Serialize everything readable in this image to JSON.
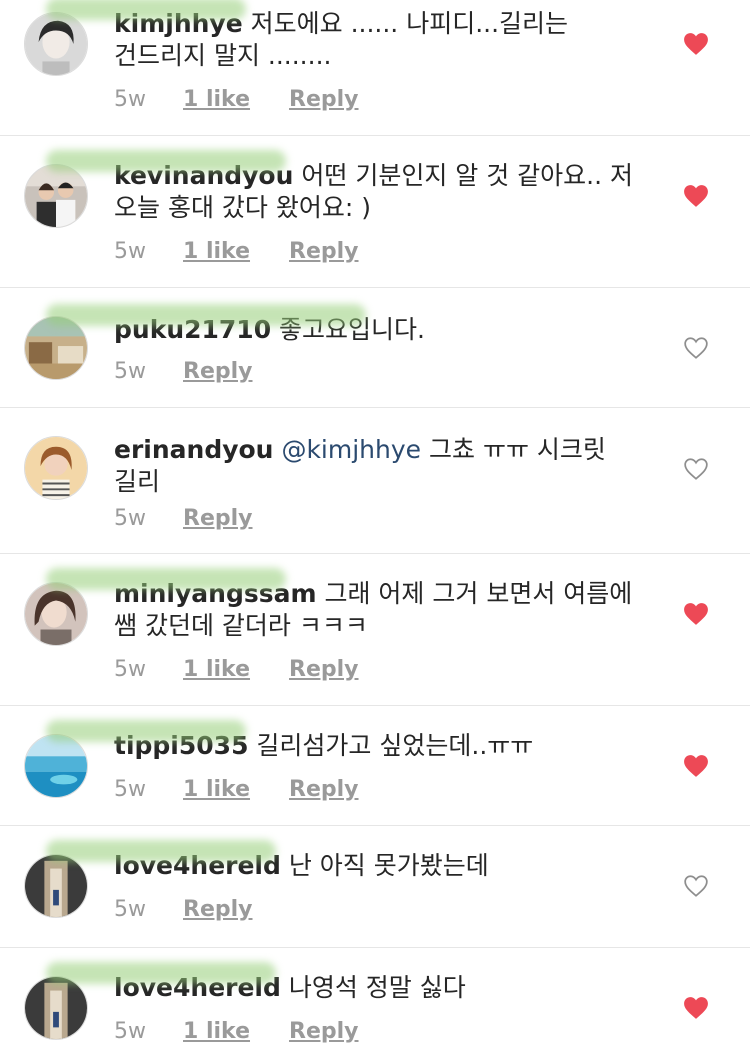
{
  "comments": [
    {
      "username": "kimjhhye",
      "text": "저도에요 ...... 나피디...길리는 건드리지 말지 ........",
      "time": "5w",
      "likes": "1 like",
      "reply": "Reply",
      "liked": true
    },
    {
      "username": "kevinandyou",
      "text": "어떤 기분인지 알 것 같아요.. 저 오늘 홍대 갔다 왔어요: )",
      "time": "5w",
      "likes": "1 like",
      "reply": "Reply",
      "liked": true
    },
    {
      "username": "puku21710",
      "text": "좋고요입니다.",
      "time": "5w",
      "reply": "Reply",
      "liked": false
    },
    {
      "username": "erinandyou",
      "mention": "@kimjhhye",
      "text": "그쵸 ㅠㅠ 시크릿 길리",
      "time": "5w",
      "reply": "Reply",
      "liked": false
    },
    {
      "username": "minlyangssam",
      "text": "그래 어제 그거 보면서 여름에 쌤 갔던데 같더라 ㅋㅋㅋ",
      "time": "5w",
      "likes": "1 like",
      "reply": "Reply",
      "liked": true
    },
    {
      "username": "tippi5035",
      "text": "길리섬가고 싶었는데..ㅠㅠ",
      "time": "5w",
      "likes": "1 like",
      "reply": "Reply",
      "liked": true
    },
    {
      "username": "love4hereld",
      "text": "난 아직 못가봤는데",
      "time": "5w",
      "reply": "Reply",
      "liked": false
    },
    {
      "username": "love4hereld",
      "text": "나영석 정말 싫다",
      "time": "5w",
      "likes": "1 like",
      "reply": "Reply",
      "liked": true
    }
  ],
  "colors": {
    "heart_filled": "#ed4956",
    "heart_outline": "#8e8e8e",
    "meta_text": "#9a9a9a",
    "mention": "#2b4a6f",
    "divider": "#e6e6e6"
  },
  "icons": {
    "liked": "heart-filled-icon",
    "not_liked": "heart-outline-icon"
  }
}
